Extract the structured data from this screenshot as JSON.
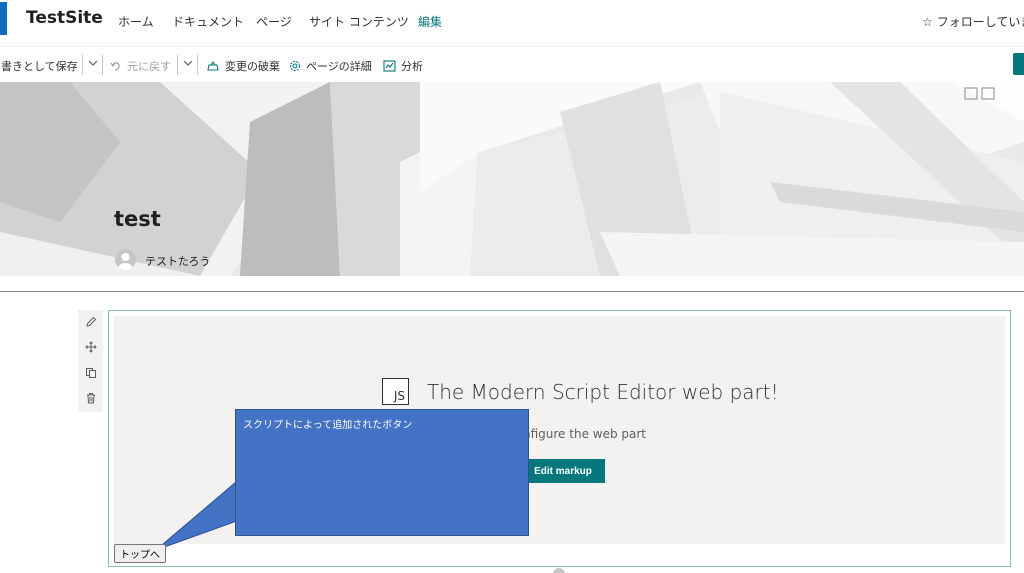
{
  "site": {
    "title": "TestSite"
  },
  "nav": {
    "items": [
      {
        "label": "ホーム"
      },
      {
        "label": "ドキュメント"
      },
      {
        "label": "ページ"
      },
      {
        "label": "サイト コンテンツ"
      },
      {
        "label": "編集"
      }
    ],
    "follow_label": "フォローしていま"
  },
  "commandbar": {
    "save_draft_label": "書きとして保存",
    "undo_label": "元に戻す",
    "discard_label": "変更の破棄",
    "page_details_label": "ページの詳細",
    "analytics_label": "分析"
  },
  "hero": {
    "title": "test",
    "author": "テストたろう"
  },
  "webpart": {
    "logo_text": "JS",
    "heading": "The Modern Script Editor web part!",
    "description": "nfigure the web part",
    "edit_button_label": "Edit markup"
  },
  "callout": {
    "text": "スクリプトによって追加されたボタン"
  },
  "script_button": {
    "label": "トップへ"
  },
  "colors": {
    "accent": "#03787c",
    "brand": "#0f6cbd",
    "callout": "#4472c4"
  }
}
